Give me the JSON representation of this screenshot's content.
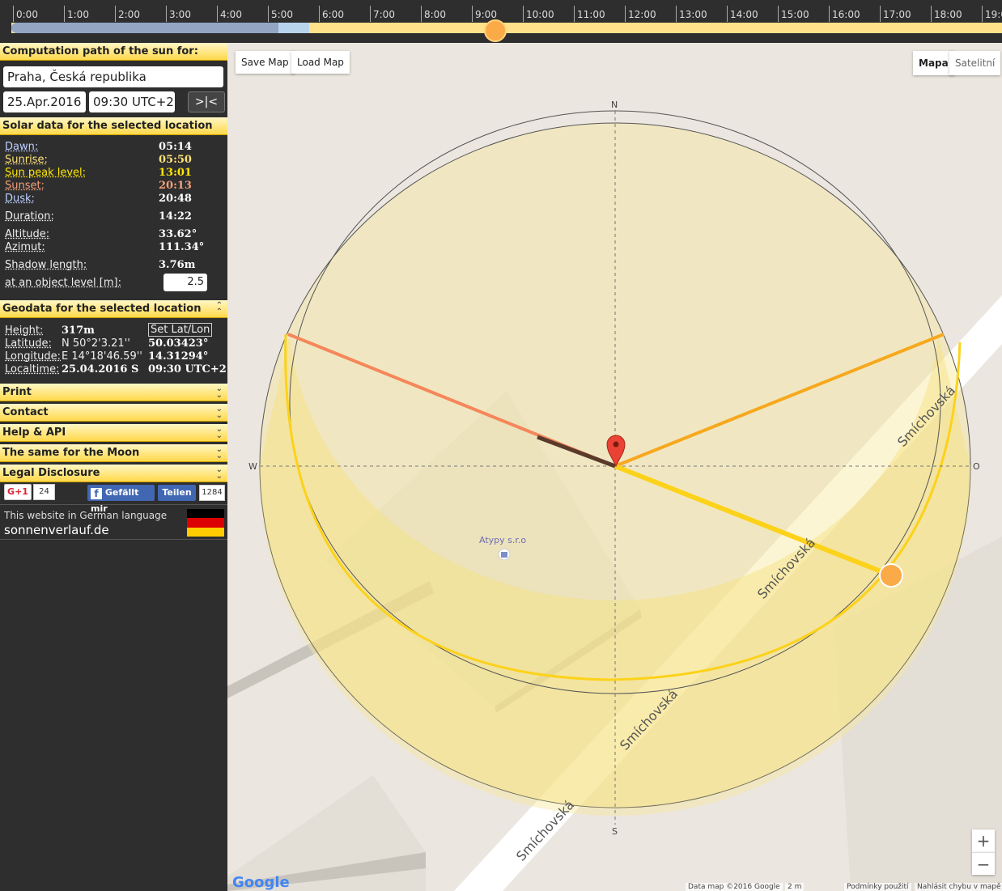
{
  "timeline": {
    "hours": [
      "0:00",
      "1:00",
      "2:00",
      "3:00",
      "4:00",
      "5:00",
      "6:00",
      "7:00",
      "8:00",
      "9:00",
      "10:00",
      "11:00",
      "12:00",
      "13:00",
      "14:00",
      "15:00",
      "16:00",
      "17:00",
      "18:00",
      "19:0"
    ]
  },
  "sidebar": {
    "computation_title": "Computation path of the sun for:",
    "location": "Praha, Česká republika",
    "date": "25.Apr.2016",
    "time": "09:30 UTC+2",
    "center_button": ">|<",
    "solar_title": "Solar data for the selected location",
    "solar": {
      "dawn_label": "Dawn:",
      "dawn": "05:14",
      "sunrise_label": "Sunrise:",
      "sunrise": "05:50",
      "peak_label": "Sun peak level:",
      "peak": "13:01",
      "sunset_label": "Sunset:",
      "sunset": "20:13",
      "dusk_label": "Dusk:",
      "dusk": "20:48",
      "duration_label": "Duration:",
      "duration": "14:22",
      "altitude_label": "Altitude:",
      "altitude": "33.62°",
      "azimut_label": "Azimut:",
      "azimut": "111.34°",
      "shadow_label": "Shadow length:",
      "shadow": "3.76m",
      "object_label": "at an object level [m]:",
      "object_level": "2.5"
    },
    "geo_title": "Geodata for the selected location",
    "geo": {
      "height_label": "Height:",
      "height": "317m",
      "set_button": "Set Lat/Lon",
      "lat_label": "Latitude:",
      "lat_dms": "N 50°2'3.21''",
      "lat_dec": "50.03423°",
      "lon_label": "Longitude:",
      "lon_dms": "E 14°18'46.59''",
      "lon_dec": "14.31294°",
      "local_label": "Localtime:",
      "local_date": "25.04.2016 S",
      "local_time": "09:30 UTC+2"
    },
    "menu": [
      "Print",
      "Contact",
      "Help & API",
      "The same for the Moon",
      "Legal Disclosure"
    ],
    "social": {
      "gplus": "G+1",
      "gplus_count": "24",
      "fb_like": "Gefällt mir",
      "share": "Teilen",
      "share_count": "1284"
    },
    "german_note": "This website in German language",
    "german_site": "sonnenverlauf.de"
  },
  "map": {
    "save_map": "Save Map",
    "load_map": "Load Map",
    "type_map": "Mapa",
    "type_sat": "Satelitní",
    "compass": {
      "n": "N",
      "s": "S",
      "w": "W",
      "e": "O"
    },
    "street": "Smíchovská",
    "poi": "Atypy s.r.o",
    "zoom_in": "+",
    "zoom_out": "−",
    "logo": "Google",
    "footer": {
      "data": "Data map ©2016 Google",
      "scale": "2 m",
      "terms": "Podmínky použití",
      "report": "Nahlásit chybu v mapě"
    },
    "colors": {
      "sunrise_line": "#f5875a",
      "sunset_line": "#f7a81e",
      "current_line": "#fcd21a",
      "path": "#fcd21a",
      "shadow": "#5a3a2a",
      "sun": "#fbaa48"
    }
  }
}
